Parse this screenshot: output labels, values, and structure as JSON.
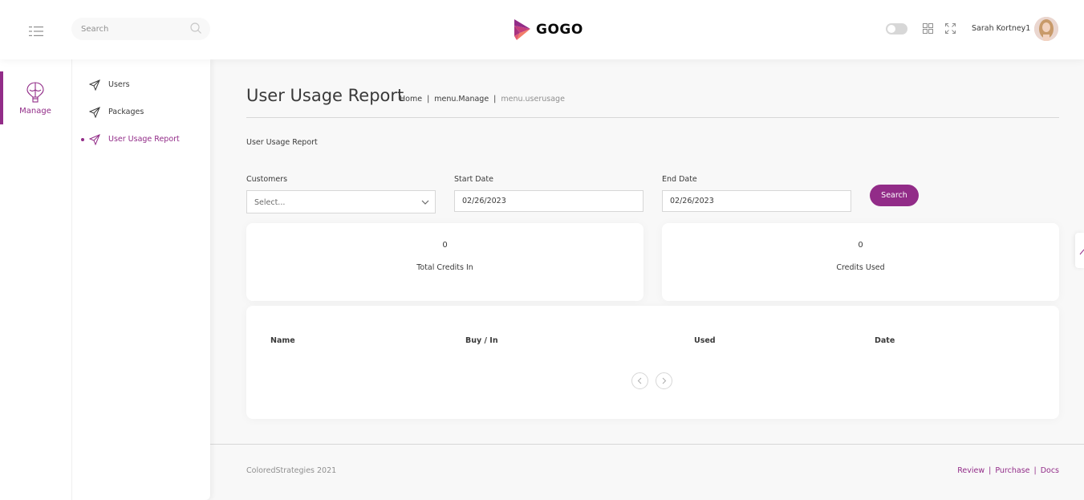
{
  "topbar": {
    "search_placeholder": "Search",
    "logo_text": "GOGO",
    "user_name": "Sarah Kortney1"
  },
  "main_menu": {
    "items": [
      {
        "label": "Manage",
        "icon": "balloon-icon",
        "active": true
      }
    ]
  },
  "sub_menu": {
    "items": [
      {
        "label": "Users",
        "icon": "send-icon",
        "active": false
      },
      {
        "label": "Packages",
        "icon": "send-icon",
        "active": false
      },
      {
        "label": "User Usage Report",
        "icon": "send-icon",
        "active": true
      }
    ]
  },
  "page": {
    "title": "User Usage Report",
    "breadcrumb": [
      "Home",
      "menu.Manage",
      "menu.userusage"
    ],
    "section_label": "User Usage Report"
  },
  "filters": {
    "customers_label": "Customers",
    "customers_value": "Select...",
    "start_date_label": "Start Date",
    "start_date_value": "02/26/2023",
    "end_date_label": "End Date",
    "end_date_value": "02/26/2023",
    "search_label": "Search"
  },
  "stats": {
    "total_credits_in": {
      "value": "0",
      "label": "Total Credits In"
    },
    "credits_used": {
      "value": "0",
      "label": "Credits Used"
    }
  },
  "table": {
    "columns": [
      "Name",
      "Buy / In",
      "Used",
      "Date"
    ],
    "rows": []
  },
  "footer": {
    "copyright": "ColoredStrategies 2021",
    "links": [
      "Review",
      "Purchase",
      "Docs"
    ]
  },
  "colors": {
    "accent": "#922c88",
    "background": "#f8f8f8",
    "card": "#ffffff",
    "text": "#3a3a3a",
    "border": "#d7d7d7"
  }
}
